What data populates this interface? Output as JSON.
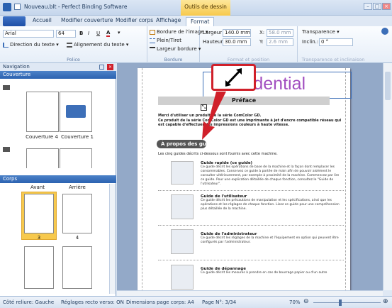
{
  "window": {
    "title": "Nouveau.blt - Perfect Binding Software",
    "context_tab": "Outils de dessin"
  },
  "tabs": [
    "Accueil",
    "Modifier couverture",
    "Modifier corps",
    "Affichage",
    "Format"
  ],
  "ribbon": {
    "police": {
      "label": "Police",
      "font_name": "Arial",
      "font_size": "64",
      "bold": "B",
      "italic": "I",
      "underline": "U",
      "font_color": "A",
      "text_direction": "Direction du texte",
      "text_align": "Alignement du texte"
    },
    "bordure": {
      "label": "Bordure",
      "image_border": "Bordure de l'image",
      "line_style": "Plein/Tiret",
      "border_width": "Largeur bordure"
    },
    "format": {
      "label": "Format et position",
      "width_label": "Largeur",
      "width_value": "140.0 mm",
      "height_label": "Hauteur",
      "height_value": "30.0 mm",
      "x_label": "X:",
      "x_value": "58.0 mm",
      "y_label": "Y:",
      "y_value": "2.6 mm"
    },
    "transparence": {
      "label": "Transparence et inclinaison",
      "transparency": "Transparence",
      "tilt_label": "Inclin.:",
      "tilt_value": "0 °"
    }
  },
  "navigation": {
    "title": "Navigation",
    "cover_section": "Couverture",
    "cover_pages": [
      "Couverture 4",
      "Couverture 1"
    ],
    "body_section": "Corps",
    "body_columns": [
      "Avant",
      "Arrière"
    ],
    "body_pages": [
      "3",
      "4"
    ]
  },
  "document": {
    "watermark": "Confidential",
    "heading": "Préface",
    "intro_1": "Merci d'utiliser un produit de la série ComColor GD.",
    "intro_2": "Ce produit de la série ComColor GD est une imprimante à jet d'encre compatible réseau qui est capable d'effectuer des impressions couleurs à haute vitesse.",
    "section_title": "À propos des guides",
    "section_intro": "Les cinq guides décrits ci-dessous sont fournis avec cette machine.",
    "guides": [
      {
        "title": "Guide rapide (ce guide)",
        "text": "Ce guide décrit les opérations de base de la machine et la façon dont remplacer les consommables. Conservez ce guide à portée de main afin de pouvoir aisément le consulter ultérieurement, par exemple à proximité de la machine. Commencez par lire ce guide. Pour une explication détaillée de chaque fonction, consultez le \"Guide de l'utilisateur\"."
      },
      {
        "title": "Guide de l'utilisateur",
        "text": "Ce guide décrit les précautions de manipulation et les spécifications, ainsi que les opérations et les réglages de chaque fonction. Lisez ce guide pour une compréhension plus détaillée de la machine."
      },
      {
        "title": "Guide de l'administrateur",
        "text": "Ce guide décrit les réglages de la machine et l'équipement en option qui peuvent être configurés par l'administrateur."
      },
      {
        "title": "Guide de dépannage",
        "text": "Ce guide décrit les mesures à prendre en cas de bourrage papier ou d'un autre"
      }
    ]
  },
  "statusbar": {
    "binding_side": "Côté reliure: Gauche",
    "duplex": "Réglages recto verso: ON",
    "page_size": "Dimensions page corps: A4",
    "page_number": "Page N°: 3/34",
    "zoom": "70%"
  },
  "colors": {
    "accent_red": "#d0202a",
    "selection_blue": "#3d6fb8",
    "header_blue": "#2b62b0",
    "watermark_purple": "#a24fc0"
  }
}
